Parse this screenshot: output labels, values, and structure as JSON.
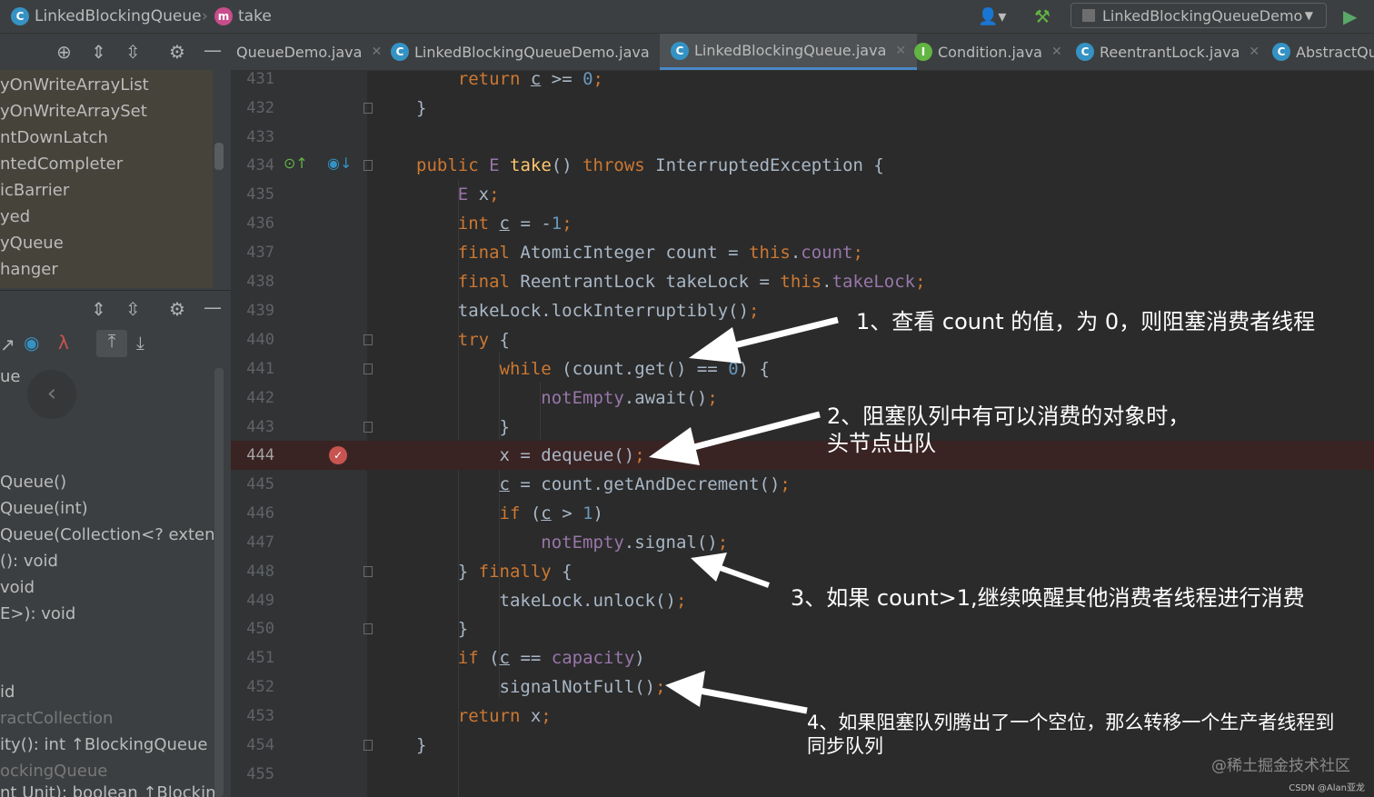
{
  "breadcrumb": {
    "class_name": "LinkedBlockingQueue",
    "method_name": "take"
  },
  "run_config": {
    "label": "LinkedBlockingQueueDemo"
  },
  "tabs": [
    {
      "label": "QueueDemo.java",
      "active": false
    },
    {
      "label": "LinkedBlockingQueueDemo.java",
      "active": false
    },
    {
      "label": "LinkedBlockingQueue.java",
      "active": true
    },
    {
      "label": "Condition.java",
      "active": false
    },
    {
      "label": "ReentrantLock.java",
      "active": false
    },
    {
      "label": "AbstractQue",
      "active": false
    }
  ],
  "structure_items": [
    "yOnWriteArrayList",
    "yOnWriteArraySet",
    "ntDownLatch",
    "ntedCompleter",
    "icBarrier",
    "yed",
    "yQueue",
    "hanger"
  ],
  "member_items": [
    "ue",
    "Queue()",
    "Queue(int)",
    "Queue(Collection<? extenc",
    "(): void",
    "void",
    "E>): void",
    "id",
    "ractCollection",
    "ity(): int ↑BlockingQueue",
    "ockingQueue",
    "nt Unit): boolean ↑Blockin"
  ],
  "editor": {
    "line_numbers": [
      "431",
      "432",
      "433",
      "434",
      "435",
      "436",
      "437",
      "438",
      "439",
      "440",
      "441",
      "442",
      "443",
      "444",
      "445",
      "446",
      "447",
      "448",
      "449",
      "450",
      "451",
      "452",
      "453",
      "454",
      "455"
    ],
    "current_line": "444"
  },
  "annotations": [
    "1、查看 count 的值，为 0，则阻塞消费者线程",
    "2、阻塞队列中有可以消费的对象时，",
    "头节点出队",
    "3、如果 count>1,继续唤醒其他消费者线程进行消费",
    "4、如果阻塞队列腾出了一个空位，那么转移一个生产者线程到",
    "同步队列"
  ],
  "watermark": "@稀土掘金技术社区",
  "watermark2": "CSDN @Alan亚龙",
  "colors": {
    "keyword": "#cc7832",
    "field": "#9876aa",
    "number": "#6897bb",
    "method": "#ffc66d",
    "accent": "#4a88c7"
  }
}
